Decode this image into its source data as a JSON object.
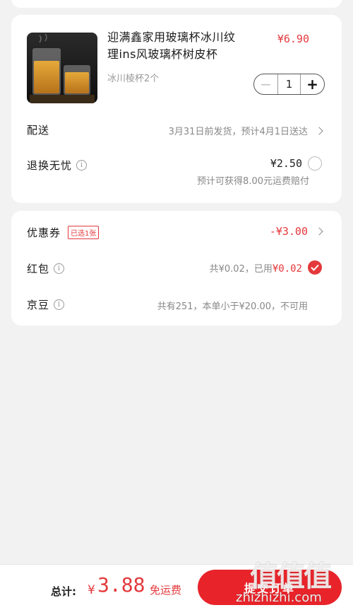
{
  "product": {
    "title": "迎满鑫家用玻璃杯冰川纹理ins风玻璃杯树皮杯",
    "price": "¥6.90",
    "spec": "冰川棱杯2个",
    "quantity": "1",
    "minus": "−",
    "plus": "+"
  },
  "shipping": {
    "label": "配送",
    "detail": "3月31日前发货，预计4月1日送达"
  },
  "return_service": {
    "label": "退换无忧",
    "price": "¥2.50",
    "note": "预计可获得8.00元运费赔付"
  },
  "coupon": {
    "label": "优惠券",
    "badge": "已选1张",
    "value": "-¥3.00"
  },
  "red_packet": {
    "label": "红包",
    "detail_prefix": "共¥0.02，已用",
    "used": "¥0.02"
  },
  "jd_beans": {
    "label": "京豆",
    "detail": "共有251，本单小于¥20.00，不可用"
  },
  "footer": {
    "total_label": "总计:",
    "currency": "¥",
    "total_amount": "3.88",
    "free_shipping": "免运费",
    "submit": "提交订单"
  },
  "watermark": {
    "logo": "值值值",
    "url": "zhizhizhi.com"
  },
  "colors": {
    "accent": "#e4393c",
    "submit_bg": "#e8242a"
  }
}
